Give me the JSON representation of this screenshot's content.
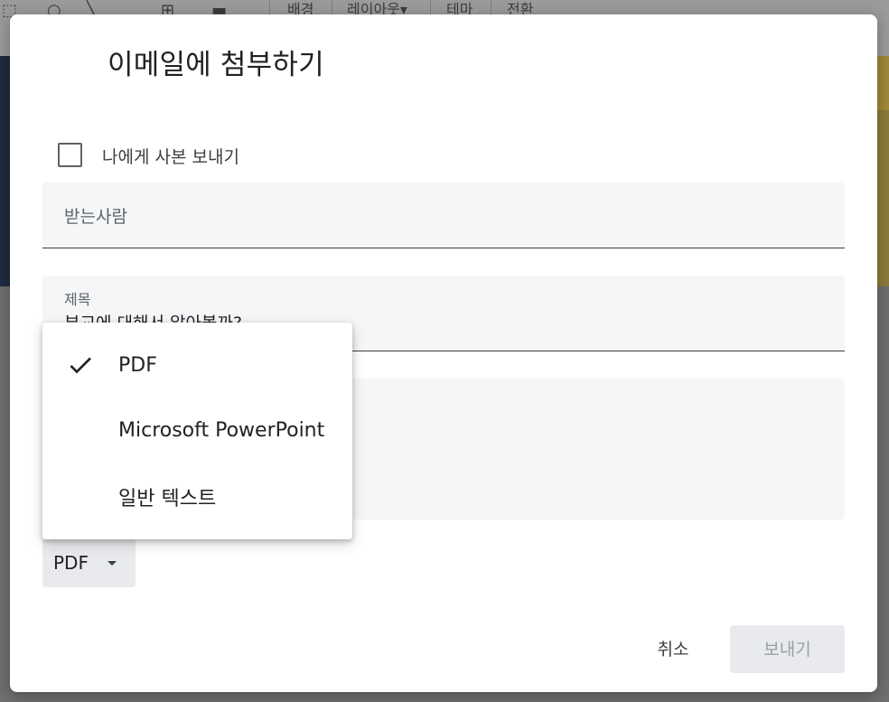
{
  "background": {
    "toolbar_items": [
      "배경",
      "레이아웃▾",
      "테마",
      "전환"
    ]
  },
  "dialog": {
    "title": "이메일에 첨부하기",
    "send_copy_label": "나에게 사본 보내기",
    "to": {
      "placeholder": "받는사람",
      "value": ""
    },
    "subject": {
      "label": "제목",
      "value": "부교에 대해서 알아볼까?"
    },
    "message": {
      "value": ""
    },
    "format": {
      "selected": "PDF"
    },
    "cancel_label": "취소",
    "send_label": "보내기"
  },
  "format_menu": {
    "items": [
      {
        "label": "PDF",
        "checked": true
      },
      {
        "label": "Microsoft PowerPoint",
        "checked": false
      },
      {
        "label": "일반 텍스트",
        "checked": false
      }
    ]
  },
  "colors": {
    "field_bg": "#f5f6f7",
    "text": "#202124",
    "muted": "#5f6368",
    "disabled": "#9aa0a6"
  }
}
